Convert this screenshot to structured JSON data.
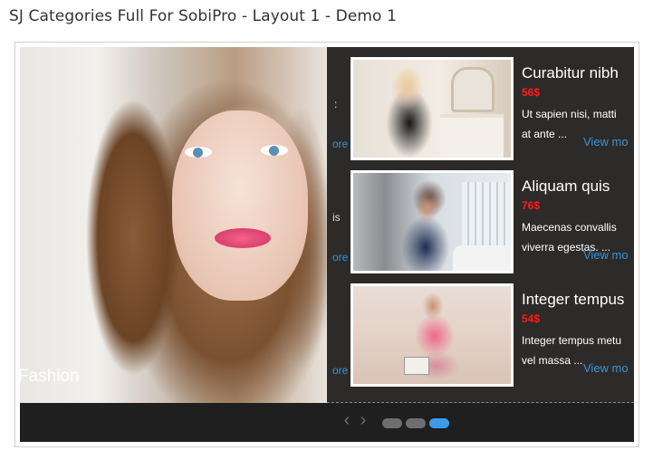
{
  "module": {
    "title": "SJ Categories Full For SobiPro - Layout 1 - Demo 1"
  },
  "slide": {
    "category": "Fashion",
    "image_icon": "portrait-photo"
  },
  "previous_column_peek": {
    "text_line": ":",
    "text_line_2": "is",
    "more_links": [
      "ore",
      "ore",
      "ore"
    ]
  },
  "items": [
    {
      "title": "Curabitur nibh",
      "price": "56$",
      "desc_line1": "Ut sapien nisi, matti",
      "desc_line2": "at ante ...",
      "more": "View mo",
      "thumb_icon": "woman-dress-photo"
    },
    {
      "title": "Aliquam quis",
      "price": "76$",
      "desc_line1": "Maecenas convallis",
      "desc_line2": "viverra egestas. ...",
      "more": "View mo",
      "thumb_icon": "woman-bedroom-photo"
    },
    {
      "title": "Integer tempus",
      "price": "54$",
      "desc_line1": "Integer tempus metu",
      "desc_line2": "vel massa ...",
      "more": "View mo",
      "thumb_icon": "woman-beach-photo"
    }
  ],
  "navigation": {
    "prev_glyph": "‹",
    "next_glyph": "›",
    "active_page": 3,
    "page_count": 3
  },
  "colors": {
    "accent_link": "#3a93d6",
    "price": "#ff1a1a",
    "active_dot": "#3d9ae8",
    "inactive_dot": "#6e6e6e"
  }
}
